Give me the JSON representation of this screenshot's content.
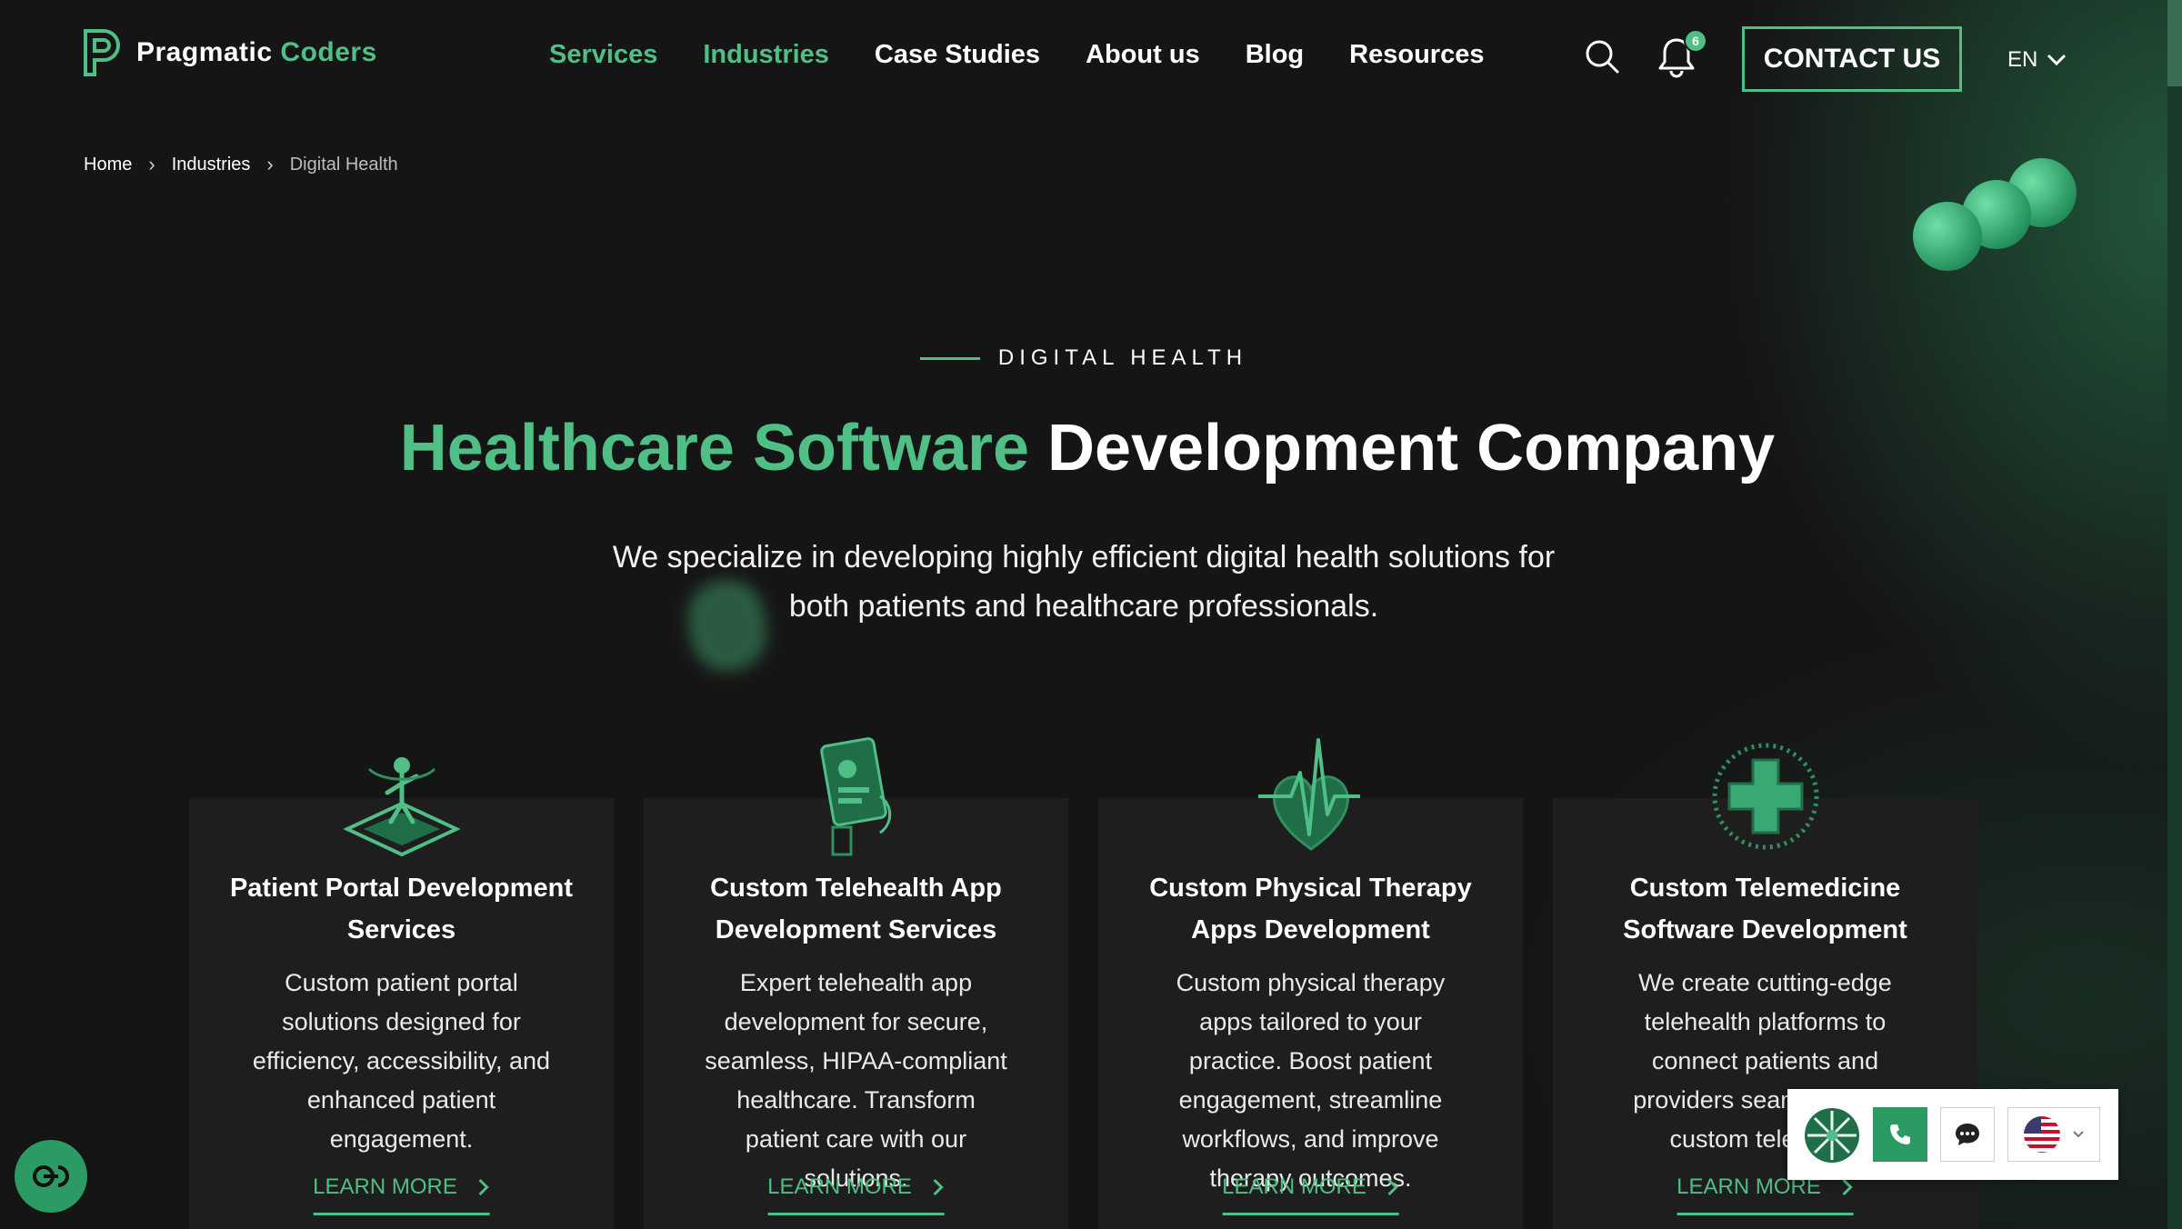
{
  "brand": {
    "name_part1": "Pragmatic",
    "name_part2": "Coders",
    "accent_color": "#4fbf86"
  },
  "nav": {
    "items": [
      {
        "label": "Services",
        "highlighted": true
      },
      {
        "label": "Industries",
        "highlighted": true
      },
      {
        "label": "Case Studies",
        "highlighted": false
      },
      {
        "label": "About us",
        "highlighted": false
      },
      {
        "label": "Blog",
        "highlighted": false
      },
      {
        "label": "Resources",
        "highlighted": false
      }
    ]
  },
  "header": {
    "search_icon": "search-icon",
    "bell_icon": "bell-icon",
    "notification_count": "6",
    "contact_label": "CONTACT US",
    "language": "EN"
  },
  "breadcrumb": {
    "home": "Home",
    "industries": "Industries",
    "current": "Digital Health"
  },
  "hero": {
    "eyebrow": "DIGITAL HEALTH",
    "title_green": "Healthcare Software",
    "title_white": " Development Company",
    "subtitle": "We specialize in developing highly efficient digital health solutions for both patients and healthcare professionals."
  },
  "cards": [
    {
      "icon": "patient-portal-icon",
      "title": "Patient Portal Development Services",
      "desc": "Custom patient portal solutions designed for efficiency, accessibility, and enhanced patient engagement.",
      "cta": "LEARN MORE"
    },
    {
      "icon": "telehealth-app-icon",
      "title": "Custom Telehealth App Development Services",
      "desc": "Expert telehealth app development for secure, seamless, HIPAA-compliant healthcare. Transform patient care with our solutions.",
      "cta": "LEARN MORE"
    },
    {
      "icon": "heartbeat-icon",
      "title": "Custom Physical Therapy Apps Development",
      "desc": "Custom physical therapy apps tailored to your practice. Boost patient engagement, streamline workflows, and improve therapy outcomes.",
      "cta": "LEARN MORE"
    },
    {
      "icon": "medical-cross-icon",
      "title": "Custom Telemedicine Software Development",
      "desc": "We create cutting-edge telehealth platforms to connect patients and providers seamlessly. Di custom telemedic",
      "cta": "LEARN MORE"
    }
  ],
  "widgets": {
    "accessibility_icon": "accessibility-icon",
    "phone_icon": "phone-icon",
    "chat_icon": "chat-icon",
    "flag_icon": "us-flag-icon"
  }
}
